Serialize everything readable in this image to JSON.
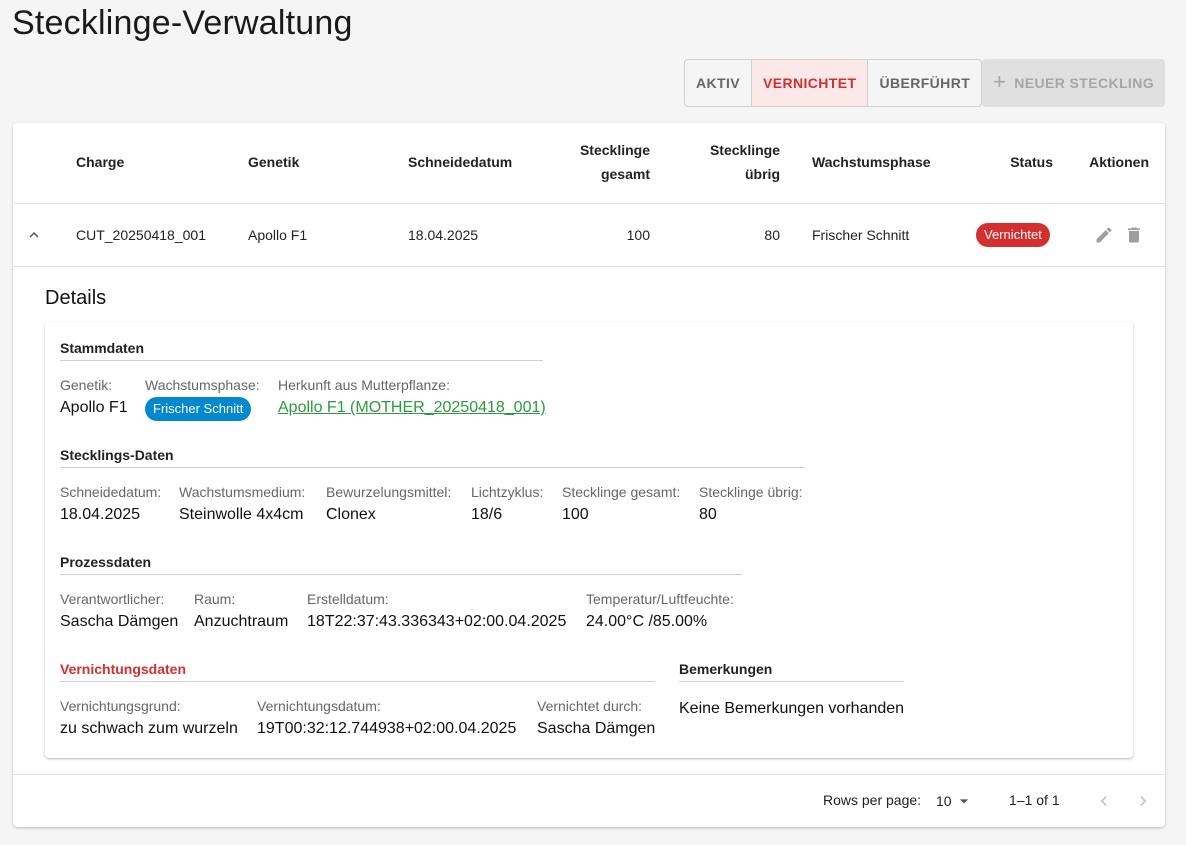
{
  "page": {
    "title": "Stecklinge-Verwaltung"
  },
  "filters": [
    {
      "label": "AKTIV",
      "active": false
    },
    {
      "label": "VERNICHTET",
      "active": true
    },
    {
      "label": "ÜBERFÜHRT",
      "active": false
    }
  ],
  "new_button": {
    "label": "NEUER STECKLING",
    "icon": "plus-icon",
    "disabled": true
  },
  "table": {
    "headers": {
      "charge": "Charge",
      "genetik": "Genetik",
      "schneidedatum": "Schneidedatum",
      "gesamt_1": "Stecklinge",
      "gesamt_2": "gesamt",
      "uebrig_1": "Stecklinge",
      "uebrig_2": "übrig",
      "phase": "Wachstumsphase",
      "status": "Status",
      "aktionen": "Aktionen"
    },
    "rows": [
      {
        "charge": "CUT_20250418_001",
        "genetik": "Apollo F1",
        "schneidedatum": "18.04.2025",
        "gesamt": "100",
        "uebrig": "80",
        "phase": "Frischer Schnitt",
        "status": "Vernichtet"
      }
    ]
  },
  "details": {
    "title": "Details",
    "stammdaten": {
      "title": "Stammdaten",
      "genetik_label": "Genetik:",
      "genetik_value": "Apollo F1",
      "phase_label": "Wachstumsphase:",
      "phase_value": "Frischer Schnitt",
      "herkunft_label": "Herkunft aus Mutterpflanze:",
      "herkunft_value": "Apollo F1 (MOTHER_20250418_001)"
    },
    "stecklingsdaten": {
      "title": "Stecklings-Daten",
      "schneidedatum_label": "Schneidedatum:",
      "schneidedatum_value": "18.04.2025",
      "medium_label": "Wachstumsmedium:",
      "medium_value": "Steinwolle 4x4cm",
      "bewurzelung_label": "Bewurzelungsmittel:",
      "bewurzelung_value": "Clonex",
      "licht_label": "Lichtzyklus:",
      "licht_value": "18/6",
      "gesamt_label": "Stecklinge gesamt:",
      "gesamt_value": "100",
      "uebrig_label": "Stecklinge übrig:",
      "uebrig_value": "80"
    },
    "prozessdaten": {
      "title": "Prozessdaten",
      "verantwortlich_label": "Verantwortlicher:",
      "verantwortlich_value": "Sascha Dämgen",
      "raum_label": "Raum:",
      "raum_value": "Anzuchtraum",
      "erstellt_label": "Erstelldatum:",
      "erstellt_value": "18T22:37:43.336343+02:00.04.2025",
      "klima_label": "Temperatur/Luftfeuchte:",
      "klima_value": "24.00°C /85.00%"
    },
    "vernichtung": {
      "title": "Vernichtungsdaten",
      "grund_label": "Vernichtungsgrund:",
      "grund_value": "zu schwach zum wurzeln",
      "datum_label": "Vernichtungsdatum:",
      "datum_value": "19T00:32:12.744938+02:00.04.2025",
      "durch_label": "Vernichtet durch:",
      "durch_value": "Sascha Dämgen"
    },
    "bemerkungen": {
      "title": "Bemerkungen",
      "text": "Keine Bemerkungen vorhanden"
    }
  },
  "pagination": {
    "rows_label": "Rows per page:",
    "rows_value": "10",
    "range": "1–1 of 1"
  },
  "colors": {
    "accent_red": "#d32f2f",
    "chip_blue": "#0288d1",
    "link_green": "#2e9a3e"
  }
}
